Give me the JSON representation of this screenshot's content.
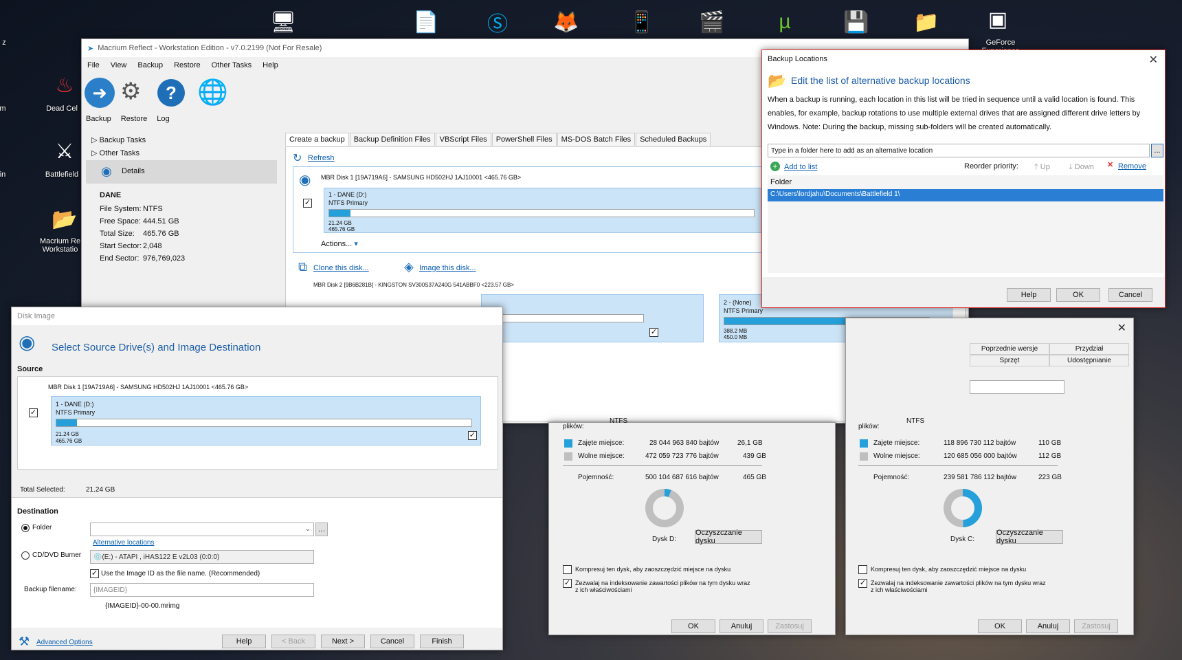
{
  "desktop": {
    "icons": [
      {
        "name": "dead-cells-icon",
        "label": "Dead Cel"
      },
      {
        "name": "battlefield-icon",
        "label": "Battlefield"
      },
      {
        "name": "macrium-icon",
        "label": "Macrium Re Workstatio"
      },
      {
        "name": "geforce-icon",
        "label": "GeForce Experience"
      }
    ],
    "left_edge": [
      "z",
      "m",
      "in"
    ]
  },
  "macrium": {
    "title": "Macrium Reflect - Workstation Edition - v7.0.2199  (Not For Resale)",
    "menu": [
      "File",
      "View",
      "Backup",
      "Restore",
      "Other Tasks",
      "Help"
    ],
    "toolbar_tabs": [
      "Backup",
      "Restore",
      "Log"
    ],
    "tree": {
      "backup_tasks": "Backup Tasks",
      "other_tasks": "Other Tasks",
      "details": "Details"
    },
    "details": {
      "name": "DANE",
      "rows": [
        {
          "k": "File System:",
          "v": "NTFS"
        },
        {
          "k": "Free Space:",
          "v": "444.51 GB"
        },
        {
          "k": "Total Size:",
          "v": "465.76 GB"
        },
        {
          "k": "Start Sector:",
          "v": "2,048"
        },
        {
          "k": "End Sector:",
          "v": "976,769,023"
        }
      ]
    },
    "tabs": [
      "Create a backup",
      "Backup Definition Files",
      "VBScript Files",
      "PowerShell Files",
      "MS-DOS Batch Files",
      "Scheduled Backups"
    ],
    "refresh": "Refresh",
    "disk1": {
      "header": "MBR Disk 1 [19A719A6] - SAMSUNG HD502HJ 1AJ10001  <465.76 GB>",
      "part_name": "1 - DANE (D:)",
      "part_type": "NTFS Primary",
      "used": "21.24 GB",
      "total": "465.76 GB",
      "fill": 0.05
    },
    "actions": "Actions...",
    "clone": "Clone this disk...",
    "image": "Image this disk...",
    "disk2_header": "MBR Disk 2 [9B6B281B] - KINGSTON SV300S37A240G 541ABBF0  <223.57 GB>",
    "disk2_part": {
      "name": "2 - (None)",
      "type": "NTFS Primary",
      "used": "388.2 MB",
      "total": "450.0 MB",
      "fill": 0.86
    }
  },
  "backup_locations": {
    "title": "Backup Locations",
    "heading": "Edit the list of alternative backup locations",
    "desc": "When a backup is running, each location in this list will be tried in sequence until a valid location is found. This enables, for example, backup rotations to use multiple external drives that are assigned different drive letters by Windows.   Note: During the backup, missing sub-folders will be created automatically.",
    "input_placeholder": "Type in a folder here to add as an alternative location",
    "browse": "...",
    "add": "Add to list",
    "reorder": "Reorder priority:",
    "up": "Up",
    "down": "Down",
    "remove": "Remove",
    "col_folder": "Folder",
    "entry": "C:\\Users\\lordjahu\\Documents\\Battlefield 1\\",
    "help": "Help",
    "ok": "OK",
    "cancel": "Cancel"
  },
  "disk_image": {
    "title": "Disk Image",
    "heading": "Select Source Drive(s) and Image Destination",
    "source": "Source",
    "disk_header": "MBR Disk 1 [19A719A6] - SAMSUNG HD502HJ 1AJ10001  <465.76 GB>",
    "part_name": "1 - DANE (D:)",
    "part_type": "NTFS Primary",
    "used": "21.24 GB",
    "total": "465.76 GB",
    "fill": 0.05,
    "total_selected_label": "Total Selected:",
    "total_selected": "21.24 GB",
    "destination": "Destination",
    "folder": "Folder",
    "alt_locations": "Alternative locations",
    "cd_burner": "CD/DVD Burner",
    "cd_value": "(E:) - ATAPI    , iHAS122   E      v2L03 (0:0:0)",
    "use_image_id": "Use the Image ID as the file name.  (Recommended)",
    "backup_filename": "Backup filename:",
    "filename_value": "{IMAGEID}",
    "filename_preview": "{IMAGEID}-00-00.mrimg",
    "advanced": "Advanced Options",
    "help": "Help",
    "back": "< Back",
    "next": "Next >",
    "cancel": "Cancel",
    "finish": "Finish"
  },
  "propsD": {
    "fs_label": "plików:",
    "fs": "NTFS",
    "used_label": "Zajęte miejsce:",
    "used_bytes": "28 044 963 840 bajtów",
    "used_gb": "26,1 GB",
    "free_label": "Wolne miejsce:",
    "free_bytes": "472 059 723 776 bajtów",
    "free_gb": "439 GB",
    "cap_label": "Pojemność:",
    "cap_bytes": "500 104 687 616 bajtów",
    "cap_gb": "465 GB",
    "used_fraction": 0.056,
    "drive": "Dysk D:",
    "cleanup": "Oczyszczanie dysku",
    "compress": "Kompresuj ten dysk, aby zaoszczędzić miejsce na dysku",
    "index": "Zezwalaj na indeksowanie zawartości plików na tym dysku wraz z ich właściwościami",
    "ok": "OK",
    "cancel": "Anuluj",
    "apply": "Zastosuj"
  },
  "propsC": {
    "tabs_top": [
      "Poprzednie wersje",
      "Przydział"
    ],
    "tabs_bottom": [
      "Sprzęt",
      "Udostępnianie"
    ],
    "fs_label": "plików:",
    "fs": "NTFS",
    "used_label": "Zajęte miejsce:",
    "used_bytes": "118 896 730 112 bajtów",
    "used_gb": "110 GB",
    "free_label": "Wolne miejsce:",
    "free_bytes": "120 685 056 000 bajtów",
    "free_gb": "112 GB",
    "cap_label": "Pojemność:",
    "cap_bytes": "239 581 786 112 bajtów",
    "cap_gb": "223 GB",
    "used_fraction": 0.496,
    "drive": "Dysk C:",
    "cleanup": "Oczyszczanie dysku",
    "compress": "Kompresuj ten dysk, aby zaoszczędzić miejsce na dysku",
    "index": "Zezwalaj na indeksowanie zawartości plików na tym dysku wraz z ich właściwościami",
    "ok": "OK",
    "cancel": "Anuluj",
    "apply": "Zastosuj"
  },
  "colors": {
    "accent": "#26a0da",
    "used": "#26a0da",
    "free": "#bfbfbf",
    "link": "#0b5fb3"
  }
}
